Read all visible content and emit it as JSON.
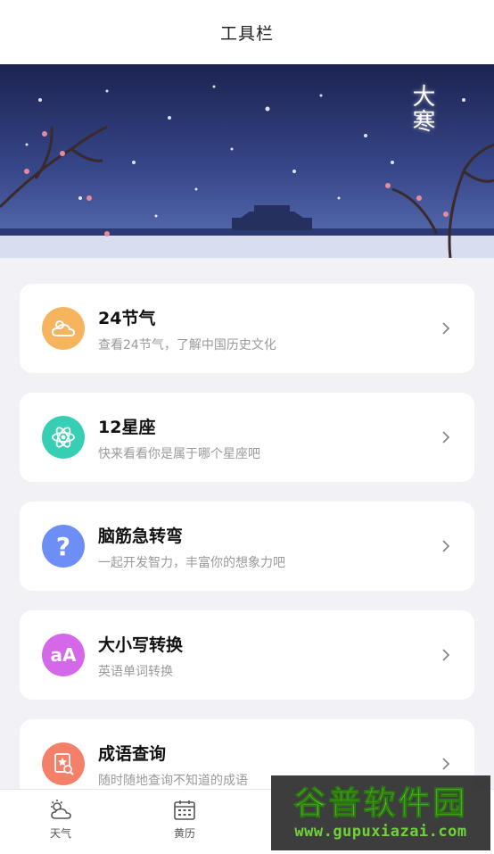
{
  "header": {
    "title": "工具栏"
  },
  "banner": {
    "title": "大寒"
  },
  "cards": [
    {
      "title": "24节气",
      "subtitle": "查看24节气，了解中国历史文化",
      "icon": "sun-cloud-icon",
      "color": "#f6b45e"
    },
    {
      "title": "12星座",
      "subtitle": "快来看看你是属于哪个星座吧",
      "icon": "atom-icon",
      "color": "#36cfb4"
    },
    {
      "title": "脑筋急转弯",
      "subtitle": "一起开发智力，丰富你的想象力吧",
      "icon": "question-icon",
      "color": "#6d8ff5"
    },
    {
      "title": "大小写转换",
      "subtitle": "英语单词转换",
      "icon": "letter-case-icon",
      "color": "#d468e8"
    },
    {
      "title": "成语查询",
      "subtitle": "随时随地查询不知道的成语",
      "icon": "book-search-icon",
      "color": "#f4806a"
    }
  ],
  "tabbar": {
    "items": [
      {
        "label": "天气",
        "icon": "weather-icon"
      },
      {
        "label": "黄历",
        "icon": "calendar-icon"
      }
    ]
  },
  "watermark": {
    "main": "谷普软件园",
    "url": "www.gupuxiazai.com"
  }
}
